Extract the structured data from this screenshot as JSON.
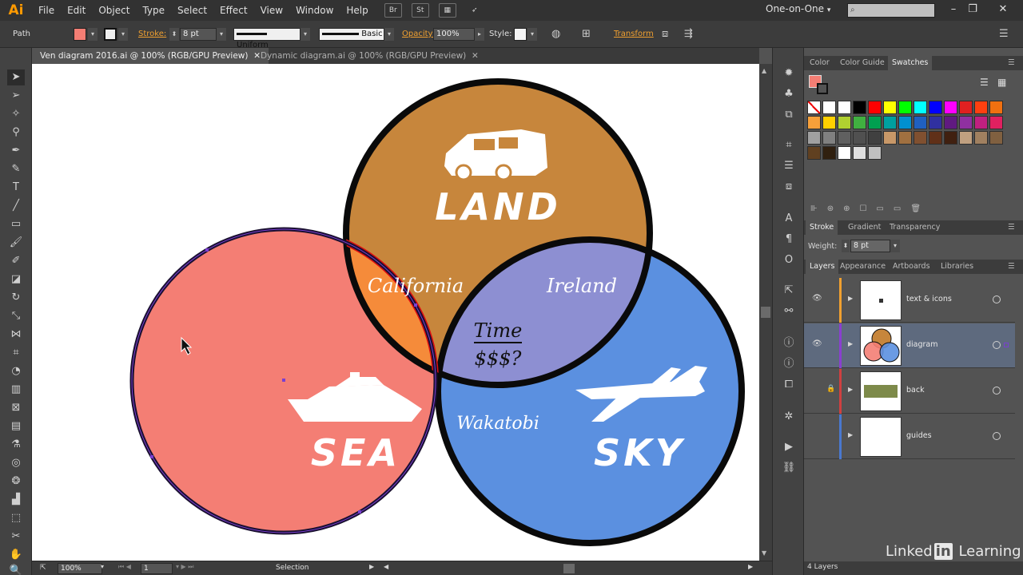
{
  "app": {
    "logo": "Ai",
    "workspace": "One-on-One",
    "workspace_arrow": "▾"
  },
  "menu": [
    "File",
    "Edit",
    "Object",
    "Type",
    "Select",
    "Effect",
    "View",
    "Window",
    "Help"
  ],
  "menubar_buttons": [
    "Br",
    "St"
  ],
  "window_controls": [
    "–",
    "❐",
    "✕"
  ],
  "control": {
    "selection_type": "Path",
    "fill_color": "#f47e74",
    "stroke_label": "Stroke:",
    "stroke_weight": "8 pt",
    "profile": "Uniform",
    "brush": "Basic",
    "opacity_label": "Opacity:",
    "opacity_value": "100%",
    "style_label": "Style:",
    "transform_label": "Transform"
  },
  "tabs": [
    {
      "label": "Ven diagram 2016.ai @ 100% (RGB/GPU Preview)",
      "close": "✕"
    },
    {
      "label": "Dynamic diagram.ai @ 100% (RGB/GPU Preview)",
      "close": "✕"
    }
  ],
  "diagram": {
    "labels": {
      "land": "LAND",
      "sea": "SEA",
      "sky": "SKY"
    },
    "intersections": {
      "land_sea": "California",
      "land_sky": "Ireland",
      "sea_sky": "Wakatobi",
      "center_top": "Time",
      "center_bottom": "$$$?"
    },
    "colors": {
      "land": "#c7863c",
      "sea": "#f47e74",
      "sky": "#5b90e0",
      "land_sea": "#f58b3a",
      "land_sky": "#8d8fd2",
      "center": "#9498d6",
      "outline": "#0a0a0a"
    }
  },
  "status": {
    "zoom": "100%",
    "artboard": "1",
    "tool": "Selection"
  },
  "panels": {
    "swatch_tabs": [
      "Color",
      "Color Guide",
      "Swatches"
    ],
    "stroke_tabs": [
      "Stroke",
      "Gradient",
      "Transparency"
    ],
    "weight_label": "Weight:",
    "weight_value": "8 pt",
    "layer_tabs": [
      "Layers",
      "Appearance",
      "Artboards",
      "Libraries"
    ],
    "layers": [
      {
        "name": "text & icons",
        "color": "#f0a030",
        "visible": "👁",
        "locked": ""
      },
      {
        "name": "diagram",
        "color": "#8a3fd0",
        "visible": "👁",
        "locked": ""
      },
      {
        "name": "back",
        "color": "#d04040",
        "visible": "",
        "locked": "🔒"
      },
      {
        "name": "guides",
        "color": "#4a78d0",
        "visible": "",
        "locked": ""
      }
    ],
    "layers_count": "4 Layers"
  },
  "watermark": {
    "brand_a": "Linked",
    "brand_in": "in",
    "brand_b": "Learning"
  },
  "swatches": [
    "#ff0000",
    "#ffff00",
    "#00ff00",
    "#00ffff",
    "#0000ff",
    "#ff00ff",
    "#e02020",
    "#ff4010",
    "#f07010",
    "#f7a03a",
    "#ffd000",
    "#b0d030",
    "#40b040",
    "#00a050",
    "#00a0a0",
    "#0090d0",
    "#2060c0",
    "#3030a0",
    "#601a80",
    "#9030a0",
    "#c02080",
    "#e02060",
    "#a0a0a0",
    "#808080",
    "#606060",
    "#505050",
    "#404040",
    "#c89868",
    "#a07040",
    "#805030",
    "#603018",
    "#402010",
    "#c0a080",
    "#a08060",
    "#806040",
    "#604020",
    "#302010",
    "#ffffff",
    "#e0e0e0",
    "#c0c0c0"
  ]
}
